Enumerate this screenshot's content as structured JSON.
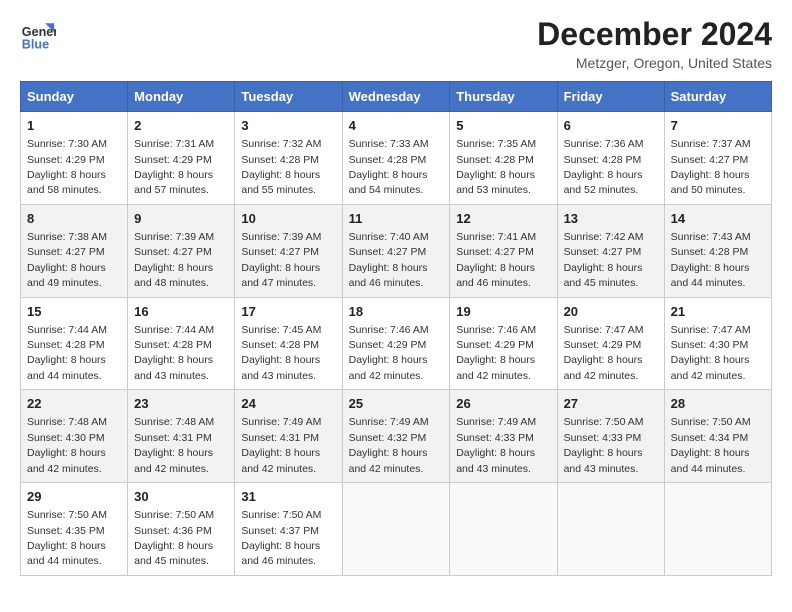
{
  "header": {
    "logo_line1": "General",
    "logo_line2": "Blue",
    "title": "December 2024",
    "location": "Metzger, Oregon, United States"
  },
  "days_of_week": [
    "Sunday",
    "Monday",
    "Tuesday",
    "Wednesday",
    "Thursday",
    "Friday",
    "Saturday"
  ],
  "weeks": [
    [
      {
        "day": "1",
        "sunrise": "Sunrise: 7:30 AM",
        "sunset": "Sunset: 4:29 PM",
        "daylight": "Daylight: 8 hours and 58 minutes."
      },
      {
        "day": "2",
        "sunrise": "Sunrise: 7:31 AM",
        "sunset": "Sunset: 4:29 PM",
        "daylight": "Daylight: 8 hours and 57 minutes."
      },
      {
        "day": "3",
        "sunrise": "Sunrise: 7:32 AM",
        "sunset": "Sunset: 4:28 PM",
        "daylight": "Daylight: 8 hours and 55 minutes."
      },
      {
        "day": "4",
        "sunrise": "Sunrise: 7:33 AM",
        "sunset": "Sunset: 4:28 PM",
        "daylight": "Daylight: 8 hours and 54 minutes."
      },
      {
        "day": "5",
        "sunrise": "Sunrise: 7:35 AM",
        "sunset": "Sunset: 4:28 PM",
        "daylight": "Daylight: 8 hours and 53 minutes."
      },
      {
        "day": "6",
        "sunrise": "Sunrise: 7:36 AM",
        "sunset": "Sunset: 4:28 PM",
        "daylight": "Daylight: 8 hours and 52 minutes."
      },
      {
        "day": "7",
        "sunrise": "Sunrise: 7:37 AM",
        "sunset": "Sunset: 4:27 PM",
        "daylight": "Daylight: 8 hours and 50 minutes."
      }
    ],
    [
      {
        "day": "8",
        "sunrise": "Sunrise: 7:38 AM",
        "sunset": "Sunset: 4:27 PM",
        "daylight": "Daylight: 8 hours and 49 minutes."
      },
      {
        "day": "9",
        "sunrise": "Sunrise: 7:39 AM",
        "sunset": "Sunset: 4:27 PM",
        "daylight": "Daylight: 8 hours and 48 minutes."
      },
      {
        "day": "10",
        "sunrise": "Sunrise: 7:39 AM",
        "sunset": "Sunset: 4:27 PM",
        "daylight": "Daylight: 8 hours and 47 minutes."
      },
      {
        "day": "11",
        "sunrise": "Sunrise: 7:40 AM",
        "sunset": "Sunset: 4:27 PM",
        "daylight": "Daylight: 8 hours and 46 minutes."
      },
      {
        "day": "12",
        "sunrise": "Sunrise: 7:41 AM",
        "sunset": "Sunset: 4:27 PM",
        "daylight": "Daylight: 8 hours and 46 minutes."
      },
      {
        "day": "13",
        "sunrise": "Sunrise: 7:42 AM",
        "sunset": "Sunset: 4:27 PM",
        "daylight": "Daylight: 8 hours and 45 minutes."
      },
      {
        "day": "14",
        "sunrise": "Sunrise: 7:43 AM",
        "sunset": "Sunset: 4:28 PM",
        "daylight": "Daylight: 8 hours and 44 minutes."
      }
    ],
    [
      {
        "day": "15",
        "sunrise": "Sunrise: 7:44 AM",
        "sunset": "Sunset: 4:28 PM",
        "daylight": "Daylight: 8 hours and 44 minutes."
      },
      {
        "day": "16",
        "sunrise": "Sunrise: 7:44 AM",
        "sunset": "Sunset: 4:28 PM",
        "daylight": "Daylight: 8 hours and 43 minutes."
      },
      {
        "day": "17",
        "sunrise": "Sunrise: 7:45 AM",
        "sunset": "Sunset: 4:28 PM",
        "daylight": "Daylight: 8 hours and 43 minutes."
      },
      {
        "day": "18",
        "sunrise": "Sunrise: 7:46 AM",
        "sunset": "Sunset: 4:29 PM",
        "daylight": "Daylight: 8 hours and 42 minutes."
      },
      {
        "day": "19",
        "sunrise": "Sunrise: 7:46 AM",
        "sunset": "Sunset: 4:29 PM",
        "daylight": "Daylight: 8 hours and 42 minutes."
      },
      {
        "day": "20",
        "sunrise": "Sunrise: 7:47 AM",
        "sunset": "Sunset: 4:29 PM",
        "daylight": "Daylight: 8 hours and 42 minutes."
      },
      {
        "day": "21",
        "sunrise": "Sunrise: 7:47 AM",
        "sunset": "Sunset: 4:30 PM",
        "daylight": "Daylight: 8 hours and 42 minutes."
      }
    ],
    [
      {
        "day": "22",
        "sunrise": "Sunrise: 7:48 AM",
        "sunset": "Sunset: 4:30 PM",
        "daylight": "Daylight: 8 hours and 42 minutes."
      },
      {
        "day": "23",
        "sunrise": "Sunrise: 7:48 AM",
        "sunset": "Sunset: 4:31 PM",
        "daylight": "Daylight: 8 hours and 42 minutes."
      },
      {
        "day": "24",
        "sunrise": "Sunrise: 7:49 AM",
        "sunset": "Sunset: 4:31 PM",
        "daylight": "Daylight: 8 hours and 42 minutes."
      },
      {
        "day": "25",
        "sunrise": "Sunrise: 7:49 AM",
        "sunset": "Sunset: 4:32 PM",
        "daylight": "Daylight: 8 hours and 42 minutes."
      },
      {
        "day": "26",
        "sunrise": "Sunrise: 7:49 AM",
        "sunset": "Sunset: 4:33 PM",
        "daylight": "Daylight: 8 hours and 43 minutes."
      },
      {
        "day": "27",
        "sunrise": "Sunrise: 7:50 AM",
        "sunset": "Sunset: 4:33 PM",
        "daylight": "Daylight: 8 hours and 43 minutes."
      },
      {
        "day": "28",
        "sunrise": "Sunrise: 7:50 AM",
        "sunset": "Sunset: 4:34 PM",
        "daylight": "Daylight: 8 hours and 44 minutes."
      }
    ],
    [
      {
        "day": "29",
        "sunrise": "Sunrise: 7:50 AM",
        "sunset": "Sunset: 4:35 PM",
        "daylight": "Daylight: 8 hours and 44 minutes."
      },
      {
        "day": "30",
        "sunrise": "Sunrise: 7:50 AM",
        "sunset": "Sunset: 4:36 PM",
        "daylight": "Daylight: 8 hours and 45 minutes."
      },
      {
        "day": "31",
        "sunrise": "Sunrise: 7:50 AM",
        "sunset": "Sunset: 4:37 PM",
        "daylight": "Daylight: 8 hours and 46 minutes."
      },
      null,
      null,
      null,
      null
    ]
  ]
}
